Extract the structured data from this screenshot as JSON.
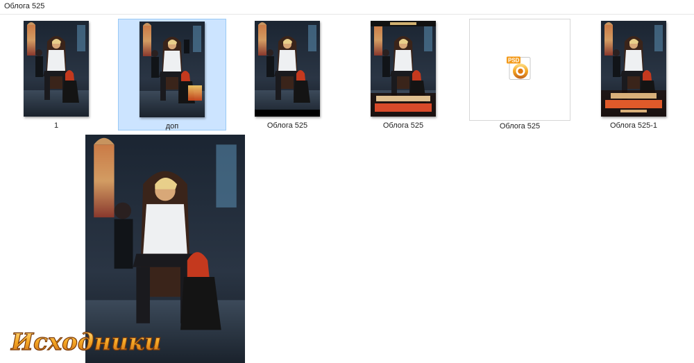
{
  "window": {
    "title": "Облога 525"
  },
  "files": [
    {
      "label": "1"
    },
    {
      "label": "доп"
    },
    {
      "label": "Облога  525"
    },
    {
      "label": "Облога 525"
    },
    {
      "label": "Облога 525"
    },
    {
      "label": "Облога 525-1"
    }
  ],
  "psd_icon": {
    "badge": "PSD"
  },
  "watermark": {
    "text": "Исходники"
  },
  "colors": {
    "selection_fill": "#cce4ff",
    "selection_border": "#99c9f5",
    "psd_orange": "#f39a1a"
  }
}
